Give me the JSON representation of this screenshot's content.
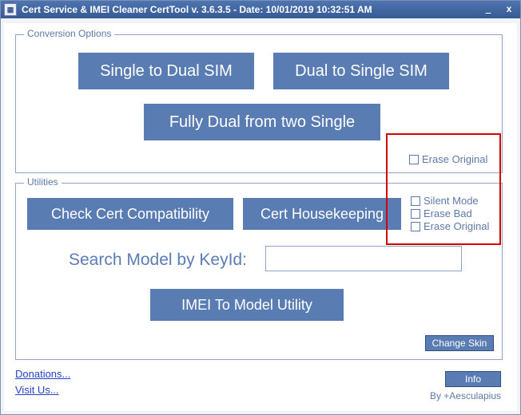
{
  "title": "Cert Service & IMEI Cleaner CertTool v. 3.6.3.5 - Date: 10/01/2019 10:32:51 AM",
  "groups": {
    "conversion": {
      "legend": "Conversion Options"
    },
    "utilities": {
      "legend": "Utilities"
    }
  },
  "buttons": {
    "single_to_dual": "Single to Dual SIM",
    "dual_to_single": "Dual to Single SIM",
    "fully_dual": "Fully Dual from two Single",
    "check_cert": "Check Cert Compatibility",
    "cert_house": "Cert Housekeeping",
    "imei_to_model": "IMEI To Model Utility",
    "change_skin": "Change Skin",
    "info": "Info"
  },
  "labels": {
    "search_model": "Search Model by KeyId:"
  },
  "inputs": {
    "search_value": ""
  },
  "checks": {
    "erase_original_top": "Erase Original",
    "silent_mode": "Silent Mode",
    "erase_bad": "Erase Bad",
    "erase_original_bot": "Erase Original"
  },
  "links": {
    "donations": "Donations...",
    "visit_us": "Visit Us..."
  },
  "credit": "By +Aesculapius"
}
